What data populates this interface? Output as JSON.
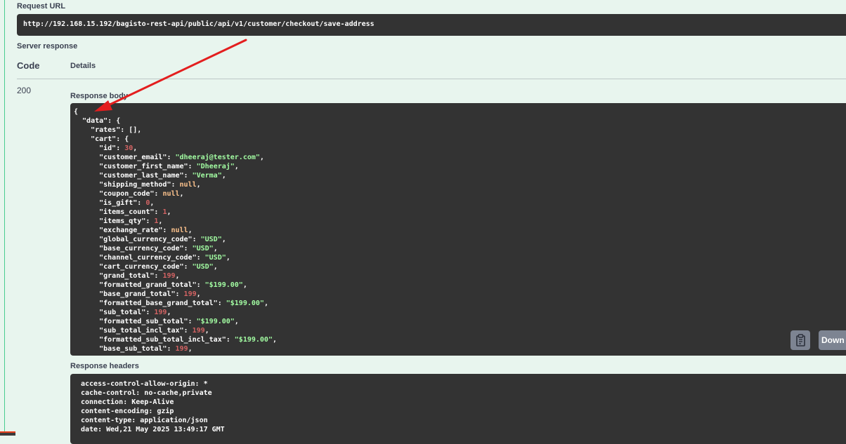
{
  "request_url": {
    "label": "Request URL",
    "value": "http://192.168.15.192/bagisto-rest-api/public/api/v1/customer/checkout/save-address"
  },
  "server_response": {
    "label": "Server response",
    "col_code": "Code",
    "col_details": "Details",
    "status_code": "200"
  },
  "response_body": {
    "label": "Response body",
    "lines": [
      [
        {
          "t": "{",
          "c": "k"
        }
      ],
      [
        {
          "t": "  \"data\": {",
          "c": "k"
        }
      ],
      [
        {
          "t": "    \"rates\": [],",
          "c": "k"
        }
      ],
      [
        {
          "t": "    \"cart\": {",
          "c": "k"
        }
      ],
      [
        {
          "t": "      \"id\": ",
          "c": "k"
        },
        {
          "t": "30",
          "c": "n"
        },
        {
          "t": ",",
          "c": "k"
        }
      ],
      [
        {
          "t": "      \"customer_email\": ",
          "c": "k"
        },
        {
          "t": "\"dheeraj@tester.com\"",
          "c": "s"
        },
        {
          "t": ",",
          "c": "k"
        }
      ],
      [
        {
          "t": "      \"customer_first_name\": ",
          "c": "k"
        },
        {
          "t": "\"Dheeraj\"",
          "c": "s"
        },
        {
          "t": ",",
          "c": "k"
        }
      ],
      [
        {
          "t": "      \"customer_last_name\": ",
          "c": "k"
        },
        {
          "t": "\"Verma\"",
          "c": "s"
        },
        {
          "t": ",",
          "c": "k"
        }
      ],
      [
        {
          "t": "      \"shipping_method\": ",
          "c": "k"
        },
        {
          "t": "null",
          "c": "l"
        },
        {
          "t": ",",
          "c": "k"
        }
      ],
      [
        {
          "t": "      \"coupon_code\": ",
          "c": "k"
        },
        {
          "t": "null",
          "c": "l"
        },
        {
          "t": ",",
          "c": "k"
        }
      ],
      [
        {
          "t": "      \"is_gift\": ",
          "c": "k"
        },
        {
          "t": "0",
          "c": "n"
        },
        {
          "t": ",",
          "c": "k"
        }
      ],
      [
        {
          "t": "      \"items_count\": ",
          "c": "k"
        },
        {
          "t": "1",
          "c": "n"
        },
        {
          "t": ",",
          "c": "k"
        }
      ],
      [
        {
          "t": "      \"items_qty\": ",
          "c": "k"
        },
        {
          "t": "1",
          "c": "n"
        },
        {
          "t": ",",
          "c": "k"
        }
      ],
      [
        {
          "t": "      \"exchange_rate\": ",
          "c": "k"
        },
        {
          "t": "null",
          "c": "l"
        },
        {
          "t": ",",
          "c": "k"
        }
      ],
      [
        {
          "t": "      \"global_currency_code\": ",
          "c": "k"
        },
        {
          "t": "\"USD\"",
          "c": "s"
        },
        {
          "t": ",",
          "c": "k"
        }
      ],
      [
        {
          "t": "      \"base_currency_code\": ",
          "c": "k"
        },
        {
          "t": "\"USD\"",
          "c": "s"
        },
        {
          "t": ",",
          "c": "k"
        }
      ],
      [
        {
          "t": "      \"channel_currency_code\": ",
          "c": "k"
        },
        {
          "t": "\"USD\"",
          "c": "s"
        },
        {
          "t": ",",
          "c": "k"
        }
      ],
      [
        {
          "t": "      \"cart_currency_code\": ",
          "c": "k"
        },
        {
          "t": "\"USD\"",
          "c": "s"
        },
        {
          "t": ",",
          "c": "k"
        }
      ],
      [
        {
          "t": "      \"grand_total\": ",
          "c": "k"
        },
        {
          "t": "199",
          "c": "n"
        },
        {
          "t": ",",
          "c": "k"
        }
      ],
      [
        {
          "t": "      \"formatted_grand_total\": ",
          "c": "k"
        },
        {
          "t": "\"$199.00\"",
          "c": "s"
        },
        {
          "t": ",",
          "c": "k"
        }
      ],
      [
        {
          "t": "      \"base_grand_total\": ",
          "c": "k"
        },
        {
          "t": "199",
          "c": "n"
        },
        {
          "t": ",",
          "c": "k"
        }
      ],
      [
        {
          "t": "      \"formatted_base_grand_total\": ",
          "c": "k"
        },
        {
          "t": "\"$199.00\"",
          "c": "s"
        },
        {
          "t": ",",
          "c": "k"
        }
      ],
      [
        {
          "t": "      \"sub_total\": ",
          "c": "k"
        },
        {
          "t": "199",
          "c": "n"
        },
        {
          "t": ",",
          "c": "k"
        }
      ],
      [
        {
          "t": "      \"formatted_sub_total\": ",
          "c": "k"
        },
        {
          "t": "\"$199.00\"",
          "c": "s"
        },
        {
          "t": ",",
          "c": "k"
        }
      ],
      [
        {
          "t": "      \"sub_total_incl_tax\": ",
          "c": "k"
        },
        {
          "t": "199",
          "c": "n"
        },
        {
          "t": ",",
          "c": "k"
        }
      ],
      [
        {
          "t": "      \"formatted_sub_total_incl_tax\": ",
          "c": "k"
        },
        {
          "t": "\"$199.00\"",
          "c": "s"
        },
        {
          "t": ",",
          "c": "k"
        }
      ],
      [
        {
          "t": "      \"base_sub_total\": ",
          "c": "k"
        },
        {
          "t": "199",
          "c": "n"
        },
        {
          "t": ",",
          "c": "k"
        }
      ]
    ],
    "copy_icon": "clipboard-icon",
    "download_label": "Down"
  },
  "response_headers": {
    "label": "Response headers",
    "lines": [
      "access-control-allow-origin: *",
      "cache-control: no-cache,private",
      "connection: Keep-Alive",
      "content-encoding: gzip",
      "content-type: application/json",
      "date: Wed,21 May 2025 13:49:17 GMT"
    ]
  },
  "colors": {
    "background": "#e8f5ee",
    "code_bg": "#333333",
    "json_string": "#a2fca2",
    "json_number": "#d36363",
    "json_literal": "#fcc28c",
    "annotation_arrow": "#e31e1e"
  }
}
